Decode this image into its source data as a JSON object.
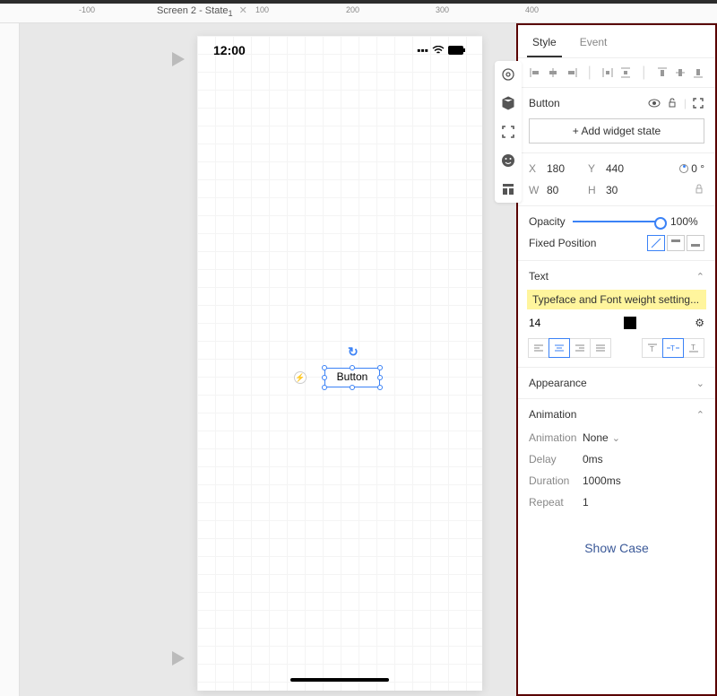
{
  "ruler_ticks": [
    "-100",
    "Screen 2 - State",
    "100",
    "1",
    "200",
    "300",
    "400"
  ],
  "ruler_positions": [
    88,
    175,
    285,
    305,
    386,
    486
  ],
  "screen_label_close": "✕",
  "canvas": {
    "time": "12:00",
    "selected_button_label": "Button"
  },
  "tabs": {
    "style": "Style",
    "event": "Event"
  },
  "widget": {
    "name": "Button",
    "add_state": "+ Add widget state",
    "x_label": "X",
    "x": "180",
    "y_label": "Y",
    "y": "440",
    "w_label": "W",
    "w": "80",
    "h_label": "H",
    "h": "30",
    "rotation": "0 °"
  },
  "opacity": {
    "label": "Opacity",
    "value": "100",
    "unit": "%"
  },
  "fixed_position_label": "Fixed Position",
  "text_section": {
    "title": "Text",
    "typeface_hint": "Typeface and Font weight setting...",
    "size": "14"
  },
  "appearance": {
    "title": "Appearance"
  },
  "animation": {
    "title": "Animation",
    "animation_label": "Animation",
    "animation_value": "None",
    "delay_label": "Delay",
    "delay_value": "0ms",
    "duration_label": "Duration",
    "duration_value": "1000ms",
    "repeat_label": "Repeat",
    "repeat_value": "1"
  },
  "show_case": "Show Case"
}
